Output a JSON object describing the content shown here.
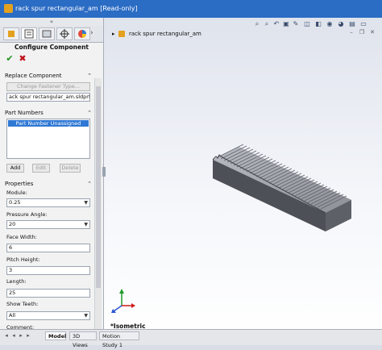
{
  "window": {
    "title": "rack spur rectangular_am [Read-only]"
  },
  "panel": {
    "tabs": [
      "feature-manager",
      "property-manager",
      "configuration-manager",
      "dimxpert-manager",
      "display-manager"
    ],
    "title": "Configure Component",
    "ok_icon": "check-icon",
    "cancel_icon": "x-icon",
    "replace_component": {
      "header": "Replace Component",
      "change_fastener_button": "Change Fastener Type...",
      "file_name": "ack spur rectangular_am.sldprt"
    },
    "part_numbers": {
      "header": "Part Numbers",
      "selected_item": "Part Number Unassigned",
      "add_button": "Add",
      "edit_button": "Edit",
      "delete_button": "Delete"
    },
    "properties": {
      "header": "Properties",
      "module_label": "Module:",
      "module_value": "0.25",
      "pressure_angle_label": "Pressure Angle:",
      "pressure_angle_value": "20",
      "face_width_label": "Face Width:",
      "face_width_value": "6",
      "pitch_height_label": "Pitch Height:",
      "pitch_height_value": "3",
      "length_label": "Length:",
      "length_value": "25",
      "show_teeth_label": "Show Teeth:",
      "show_teeth_value": "All",
      "comment_label": "Comment:"
    }
  },
  "viewport": {
    "tree_node": "rack spur rectangular_am",
    "view_label": "*Isometric"
  },
  "bottom_tabs": [
    "Model",
    "3D Views",
    "Motion Study 1"
  ],
  "colors": {
    "titlebar": "#2b6cc4",
    "selection": "#2f78d4",
    "ok": "#1e8f1e",
    "cancel": "#c0121a",
    "part_top": "#a7aab0",
    "part_side": "#5b5e64"
  }
}
